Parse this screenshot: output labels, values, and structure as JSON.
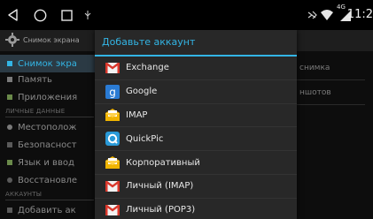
{
  "status_bar": {
    "time": "11:2",
    "network": "4G",
    "icons": [
      "back-icon",
      "home-icon",
      "recents-icon",
      "usb-icon",
      "bluetooth-off-icon",
      "wifi-icon",
      "signal-4g-icon"
    ]
  },
  "settings": {
    "header_title": "Снимок экрана",
    "items": [
      {
        "label": "Снимок экра",
        "icon": "screenshot-icon",
        "selected": true
      },
      {
        "label": "Память",
        "icon": "storage-icon"
      },
      {
        "label": "Приложения",
        "icon": "apps-icon"
      }
    ],
    "section_personal": "ЛИЧНЫЕ ДАННЫЕ",
    "personal_items": [
      {
        "label": "Местополож",
        "icon": "location-icon"
      },
      {
        "label": "Безопасност",
        "icon": "security-icon"
      },
      {
        "label": "Язык и ввод",
        "icon": "language-icon"
      },
      {
        "label": "Восстановле",
        "icon": "backup-icon"
      }
    ],
    "section_accounts": "АККАУНТЫ",
    "accounts_items": [
      {
        "label": "Добавить ак",
        "icon": "add-icon"
      }
    ],
    "right_panel": [
      "снимка",
      "ншотов"
    ]
  },
  "dialog": {
    "title": "Добавьте аккаунт",
    "items": [
      {
        "label": "Exchange",
        "icon": "gmail-icon"
      },
      {
        "label": "Google",
        "icon": "google-icon"
      },
      {
        "label": "IMAP",
        "icon": "email-envelope-icon"
      },
      {
        "label": "QuickPic",
        "icon": "quickpic-icon"
      },
      {
        "label": "Корпоративный",
        "icon": "email-envelope-icon"
      },
      {
        "label": "Личный (IMAP)",
        "icon": "gmail-icon"
      },
      {
        "label": "Личный (POP3)",
        "icon": "gmail-icon"
      }
    ]
  },
  "colors": {
    "accent": "#33b5e5",
    "dialog_bg": "#282828",
    "background": "#0d0d0d"
  }
}
